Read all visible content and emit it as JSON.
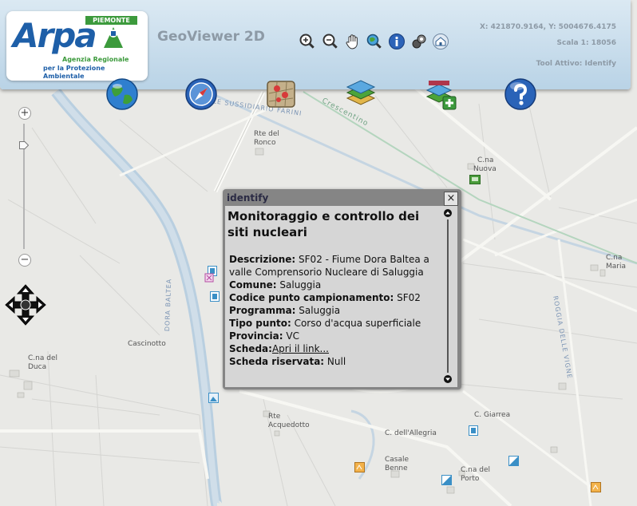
{
  "header": {
    "logo_brand": "Arpa",
    "logo_region": "PIEMONTE",
    "logo_line1": "Agenzia Regionale",
    "logo_line2": "per la Protezione Ambientale",
    "app_title": "GeoViewer 2D",
    "coordinates": "X: 421870.9164, Y: 5004676.4175",
    "scale": "Scala 1: 18056",
    "active_tool": "Tool Attivo: Identify"
  },
  "toolbar": {
    "small_tools": [
      "zoom-in-icon",
      "zoom-out-icon",
      "pan-hand-icon",
      "zoom-extent-icon",
      "info-icon",
      "layers-icon",
      "home-icon"
    ],
    "big_tools": [
      "globe-icon",
      "compass-icon",
      "map-pin-icon",
      "map-layers-icon",
      "add-layer-icon",
      "help-icon"
    ]
  },
  "zoom": {
    "plus": "+",
    "minus": "−"
  },
  "map_labels": {
    "rte_del_ronco_1": "Rte del",
    "rte_del_ronco_2": "Ronco",
    "cna_nuova_1": "C.na",
    "cna_nuova_2": "Nuova",
    "cna_maria_1": "C.na",
    "cna_maria_2": "Maria",
    "cascinotto": "Cascinotto",
    "cna_del_duca_1": "C.na del",
    "cna_del_duca_2": "Duca",
    "rte_acquedotto_1": "Rte",
    "rte_acquedotto_2": "Acquedotto",
    "c_giarrea": "C. Giarrea",
    "c_dell_allegria": "C. dell'Allegria",
    "casale_benne_1": "Casale",
    "casale_benne_2": "Benne",
    "cna_del_porto_1": "C.na del",
    "cna_del_porto_2": "Porto",
    "road_farini": "LE SUSSIDIARIO FARINI",
    "road_crescentino": "Crescentino",
    "river_dora": "DORA BALTEA",
    "road_vigne": "ROGGIA DELLE VIGNE"
  },
  "popup": {
    "title": "identify",
    "close": "×",
    "heading": "Monitoraggio e controllo dei siti nucleari",
    "fields": {
      "descrizione_label": "Descrizione:",
      "descrizione_value": " SF02 - Fiume Dora Baltea a valle Comprensorio Nucleare di Saluggia",
      "comune_label": "Comune:",
      "comune_value": " Saluggia",
      "codice_label": "Codice punto campionamento:",
      "codice_value": " SF02",
      "programma_label": "Programma:",
      "programma_value": " Saluggia",
      "tipo_label": "Tipo punto:",
      "tipo_value": " Corso d'acqua superficiale",
      "provincia_label": "Provincia:",
      "provincia_value": " VC",
      "scheda_label": "Scheda:",
      "scheda_link": "Apri il link...",
      "riservata_label": "Scheda riservata:",
      "riservata_value": " Null"
    }
  },
  "colors": {
    "header_top": "#dbe9f3",
    "header_bottom": "#b9d3e6",
    "logo_blue": "#1e5fa8",
    "logo_green": "#3c9a3c",
    "map_bg": "#e9e9e6",
    "river": "#b9cfe0",
    "popup_frame": "#858585",
    "popup_body": "#d6d6d6"
  }
}
